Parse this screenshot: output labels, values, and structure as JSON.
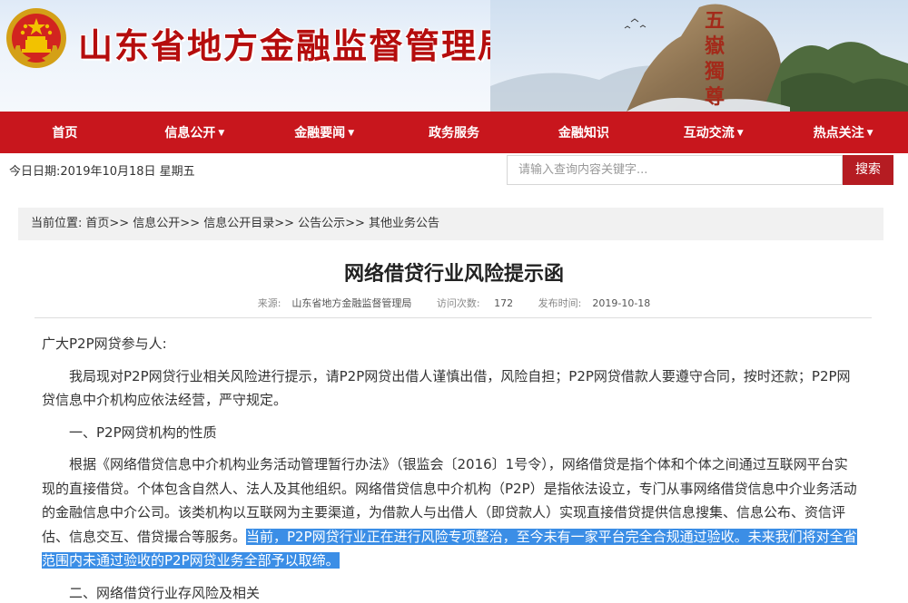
{
  "header": {
    "site_title": "山东省地方金融监督管理局",
    "mountain_calligraphy": [
      "五",
      "嶽",
      "獨",
      "尊"
    ],
    "colors": {
      "brand_red": "#c8161d",
      "title_red": "#b50d0d",
      "highlight": "#3b8ee6"
    }
  },
  "nav": {
    "items": [
      {
        "label": "首页",
        "dropdown": false
      },
      {
        "label": "信息公开",
        "dropdown": true
      },
      {
        "label": "金融要闻",
        "dropdown": true
      },
      {
        "label": "政务服务",
        "dropdown": false
      },
      {
        "label": "金融知识",
        "dropdown": false
      },
      {
        "label": "互动交流",
        "dropdown": true
      },
      {
        "label": "热点关注",
        "dropdown": true
      }
    ]
  },
  "toolbar": {
    "date_text": "今日日期:2019年10月18日 星期五",
    "search_placeholder": "请输入查询内容关键字...",
    "search_button": "搜索"
  },
  "breadcrumb": {
    "prefix": "当前位置:",
    "path": "首页>> 信息公开>> 信息公开目录>> 公告公示>> 其他业务公告"
  },
  "article": {
    "title": "网络借贷行业风险提示函",
    "meta": {
      "source_label": "来源:",
      "source": "山东省地方金融监督管理局",
      "views_label": "访问次数:",
      "views": "172",
      "date_label": "发布时间:",
      "date": "2019-10-18"
    },
    "greeting": "广大P2P网贷参与人:",
    "para1": "我局现对P2P网贷行业相关风险进行提示，请P2P网贷出借人谨慎出借，风险自担；P2P网贷借款人要遵守合同，按时还款；P2P网贷信息中介机构应依法经营，严守规定。",
    "section1": "一、P2P网贷机构的性质",
    "para2_plain": "根据《网络借贷信息中介机构业务活动管理暂行办法》（银监会〔2016〕1号令），网络借贷是指个体和个体之间通过互联网平台实现的直接借贷。个体包含自然人、法人及其他组织。网络借贷信息中介机构（P2P）是指依法设立，专门从事网络借贷信息中介业务活动的金融信息中介公司。该类机构以互联网为主要渠道，为借款人与出借人（即贷款人）实现直接借贷提供信息搜集、信息公布、资信评估、信息交互、借贷撮合等服务。",
    "para2_highlighted": "当前，P2P网贷行业正在进行风险专项整治，至今未有一家平台完全合规通过验收。未来我们将对全省范围内未通过验收的P2P网贷业务全部予以取缔。",
    "section2": "二、网络借贷行业存风险及相关"
  }
}
